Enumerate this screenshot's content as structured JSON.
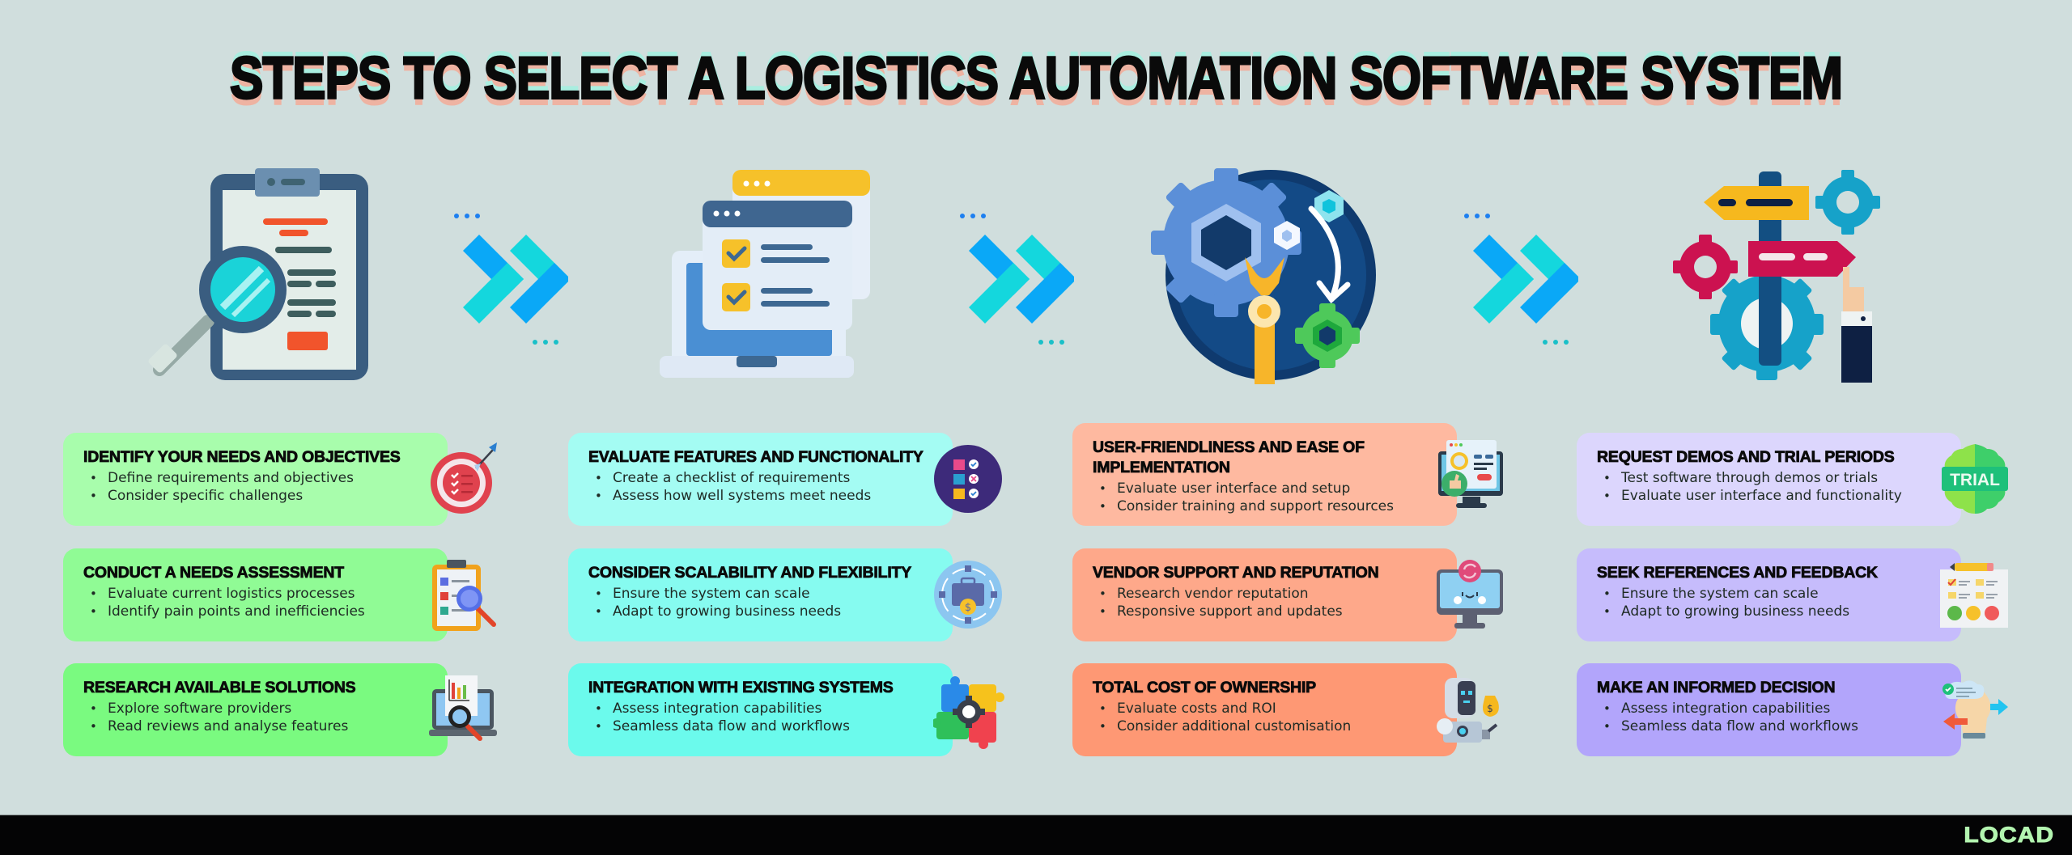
{
  "title": "STEPS TO SELECT A LOGISTICS AUTOMATION SOFTWARE SYSTEM",
  "illustrations": [
    {
      "icon": "clipboard-magnifier-icon"
    },
    {
      "icon": "laptop-checklist-icon"
    },
    {
      "icon": "gears-wrench-icon"
    },
    {
      "icon": "signpost-gears-icon"
    }
  ],
  "arrows": [
    {
      "icon": "double-chevron-right-icon"
    },
    {
      "icon": "double-chevron-right-icon"
    },
    {
      "icon": "double-chevron-right-icon"
    }
  ],
  "columns": [
    {
      "colors": [
        "#a8fdac",
        "#90fb95",
        "#7afa80"
      ],
      "cards": [
        {
          "title": "IDENTIFY YOUR NEEDS AND OBJECTIVES",
          "bullets": [
            "Define requirements and objectives",
            "Consider specific challenges"
          ],
          "icon": "target-checklist-icon"
        },
        {
          "title": "CONDUCT A NEEDS ASSESSMENT",
          "bullets": [
            "Evaluate current logistics processes",
            "Identify pain points and inefficiencies"
          ],
          "icon": "clipboard-search-icon"
        },
        {
          "title": "RESEARCH AVAILABLE SOLUTIONS",
          "bullets": [
            "Explore software providers",
            "Read reviews and analyse features"
          ],
          "icon": "laptop-chart-search-icon"
        }
      ]
    },
    {
      "colors": [
        "#a4fcf3",
        "#86fbf0",
        "#6bfaec"
      ],
      "cards": [
        {
          "title": "EVALUATE FEATURES AND FUNCTIONALITY",
          "bullets": [
            "Create a checklist of requirements",
            "Assess how well systems meet needs"
          ],
          "icon": "checklist-circle-icon"
        },
        {
          "title": "CONSIDER SCALABILITY AND FLEXIBILITY",
          "bullets": [
            "Ensure the system can scale",
            "Adapt to growing business needs"
          ],
          "icon": "briefcase-cycle-icon"
        },
        {
          "title": "INTEGRATION WITH EXISTING SYSTEMS",
          "bullets": [
            "Assess integration capabilities",
            "Seamless data flow and workflows"
          ],
          "icon": "puzzle-gear-icon"
        }
      ]
    },
    {
      "colors": [
        "#feb9a0",
        "#fea88a",
        "#fe9874"
      ],
      "cards": [
        {
          "title": "USER-FRIENDLINESS AND EASE OF IMPLEMENTATION",
          "bullets": [
            "Evaluate user interface and setup",
            "Consider training and support resources"
          ],
          "icon": "monitor-thumbs-up-icon"
        },
        {
          "title": "VENDOR SUPPORT AND REPUTATION",
          "bullets": [
            "Research vendor reputation",
            "Responsive support and updates"
          ],
          "icon": "monitor-sync-icon"
        },
        {
          "title": "TOTAL COST OF OWNERSHIP",
          "bullets": [
            "Evaluate costs and ROI",
            "Consider additional customisation"
          ],
          "icon": "robot-money-icon"
        }
      ]
    },
    {
      "colors": [
        "#dcd6fd",
        "#c6bcfc",
        "#b2a5fb"
      ],
      "cards": [
        {
          "title": "REQUEST DEMOS AND TRIAL PERIODS",
          "bullets": [
            "Test software through demos or trials",
            "Evaluate user interface and functionality"
          ],
          "icon": "trial-badge-icon",
          "badge": "TRIAL"
        },
        {
          "title": "SEEK REFERENCES AND FEEDBACK",
          "bullets": [
            "Ensure the system can scale",
            "Adapt to growing business needs"
          ],
          "icon": "feedback-survey-icon"
        },
        {
          "title": "MAKE AN INFORMED DECISION",
          "bullets": [
            "Assess integration capabilities",
            "Seamless data flow and workflows"
          ],
          "icon": "head-decision-icon"
        }
      ]
    }
  ],
  "footer": {
    "logo": "LOCAD",
    "logo_color": "#b3f5b0"
  }
}
